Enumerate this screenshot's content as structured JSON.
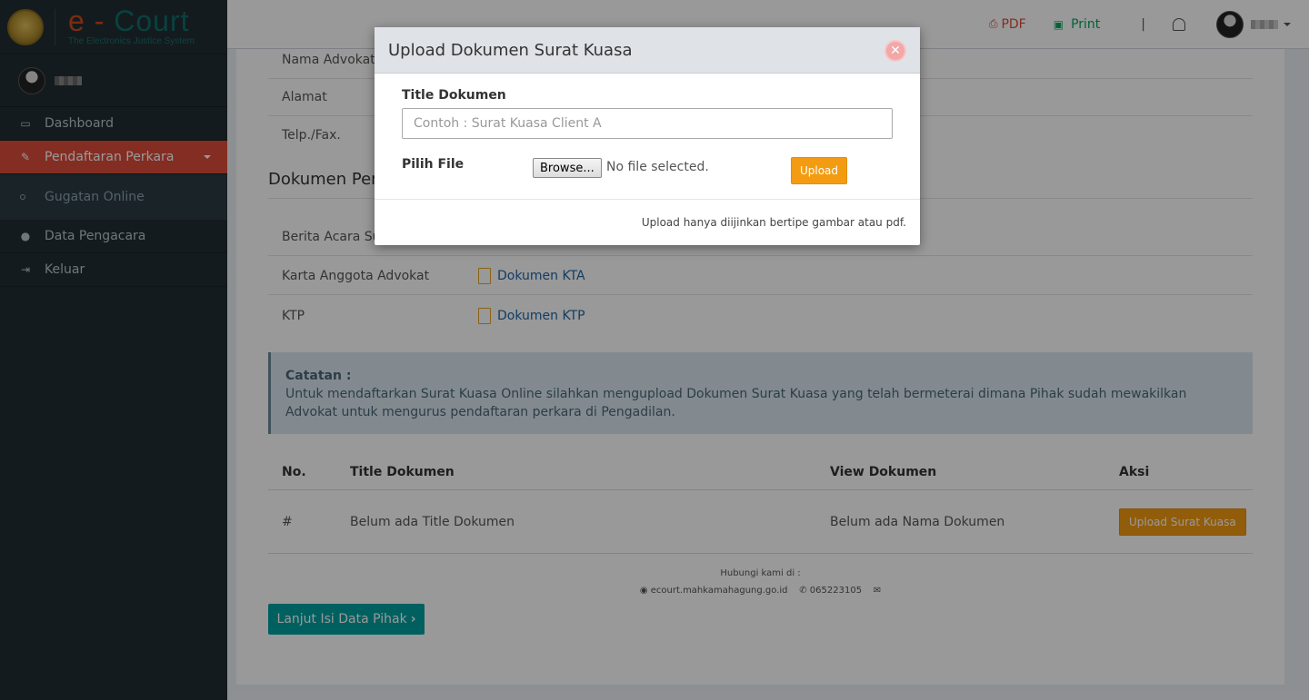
{
  "brand": {
    "logo_left": "e - ",
    "logo_right": "Court",
    "tagline": "The Electronics Justice System"
  },
  "sidebar": {
    "items": [
      {
        "label": "Dashboard",
        "icon": "laptop-icon"
      },
      {
        "label": "Pendaftaran Perkara",
        "icon": "edit-icon",
        "active": true
      },
      {
        "label": "Gugatan Online",
        "icon": "circle-icon",
        "sub": true
      },
      {
        "label": "Data Pengacara",
        "icon": "user-icon"
      },
      {
        "label": "Keluar",
        "icon": "sign-out-icon"
      }
    ]
  },
  "topbar": {
    "pdf_label": "PDF",
    "print_label": "Print",
    "separator": "|"
  },
  "advokat": {
    "rows": [
      {
        "label": "Nama Advokat"
      },
      {
        "label": "Alamat"
      },
      {
        "label": "Telp./Fax."
      }
    ]
  },
  "dokumen": {
    "section_title": "Dokumen Pen",
    "rows": [
      {
        "label": "Berita Acara Su",
        "link": ""
      },
      {
        "label": "Karta Anggota Advokat",
        "link": "Dokumen KTA"
      },
      {
        "label": "KTP",
        "link": "Dokumen KTP"
      }
    ]
  },
  "note": {
    "title": "Catatan :",
    "text": "Untuk mendaftarkan Surat Kuasa Online silahkan mengupload Dokumen Surat Kuasa yang telah bermeterai dimana Pihak sudah mewakilkan Advokat untuk mengurus pendaftaran perkara di Pengadilan."
  },
  "table": {
    "headers": [
      "No.",
      "Title Dokumen",
      "View Dokumen",
      "Aksi"
    ],
    "rows": [
      {
        "no": "#",
        "title": "Belum ada Title Dokumen",
        "view": "Belum ada Nama Dokumen",
        "action": "Upload Surat Kuasa"
      }
    ]
  },
  "contact": {
    "heading": "Hubungi kami di :",
    "website": "ecourt.mahkamahagung.go.id",
    "phone": "065223105"
  },
  "next_button": "Lanjut Isi Data Pihak",
  "modal": {
    "title": "Upload Dokumen Surat Kuasa",
    "title_label": "Title Dokumen",
    "title_placeholder": "Contoh : Surat Kuasa Client A",
    "file_label": "Pilih File",
    "browse_label": "Browse...",
    "no_file_text": "No file selected.",
    "upload_label": "Upload",
    "footer_note": "Upload hanya diijinkan bertipe gambar atau pdf.",
    "close_glyph": "✕"
  },
  "colors": {
    "sidebar_bg": "#222d32",
    "active_menu": "#dd4b39",
    "accent_orange": "#f39c12",
    "next_button": "#00a0a0",
    "pdf": "#dd4b39",
    "print": "#00a65a"
  }
}
